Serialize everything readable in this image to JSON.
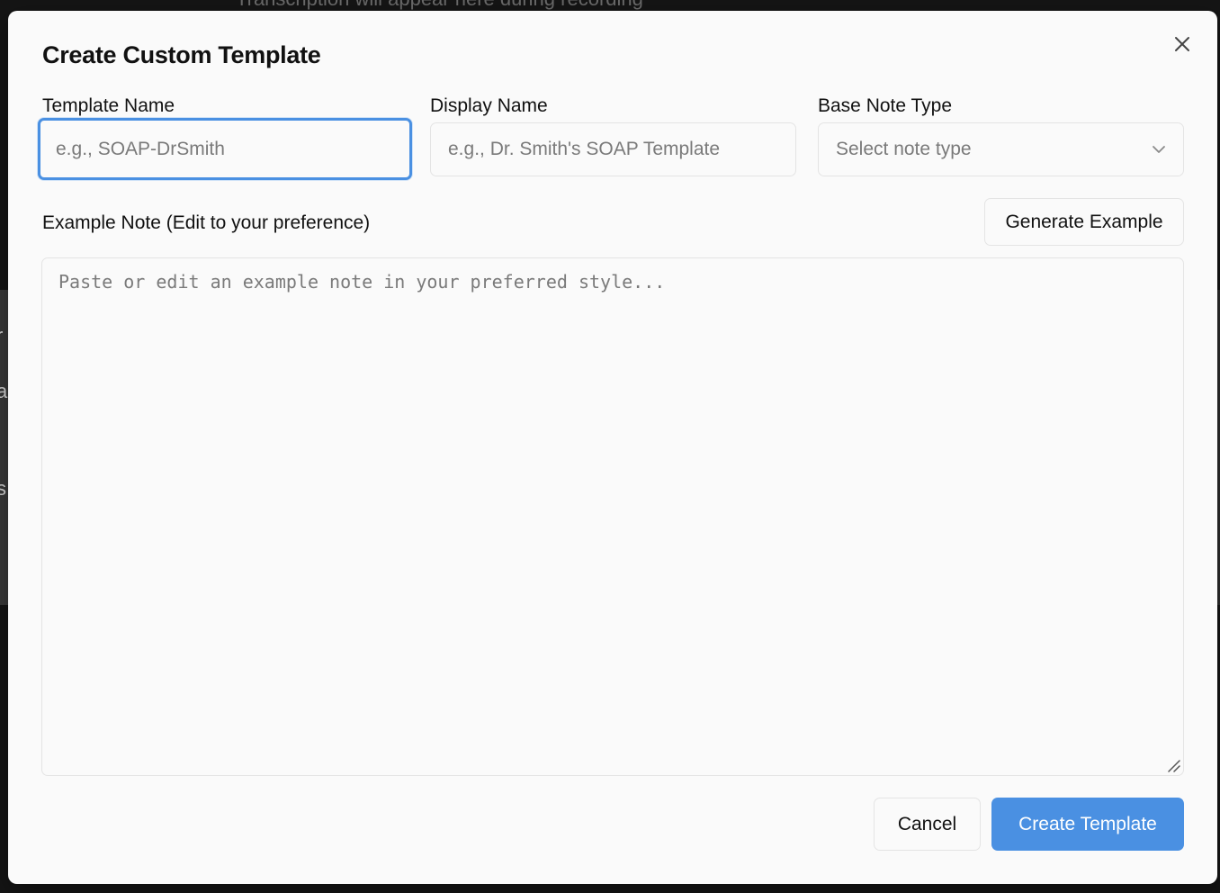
{
  "background": {
    "top_text": "Transcription will appear here during recording",
    "left_fragments": [
      "r",
      "a",
      "s"
    ]
  },
  "dialog": {
    "title": "Create Custom Template",
    "close_icon": "close-icon",
    "fields": {
      "template_name": {
        "label": "Template Name",
        "placeholder": "e.g., SOAP-DrSmith",
        "value": "",
        "focused": true
      },
      "display_name": {
        "label": "Display Name",
        "placeholder": "e.g., Dr. Smith's SOAP Template",
        "value": ""
      },
      "base_note_type": {
        "label": "Base Note Type",
        "placeholder": "Select note type",
        "icon": "chevron-down-icon"
      }
    },
    "example_note": {
      "label": "Example Note (Edit to your preference)",
      "generate_label": "Generate Example",
      "placeholder": "Paste or edit an example note in your preferred style...",
      "value": ""
    },
    "actions": {
      "cancel_label": "Cancel",
      "create_label": "Create Template"
    },
    "colors": {
      "accent": "#4a90e2",
      "dialog_bg": "#fafafa",
      "border": "#e4e4e4"
    }
  }
}
